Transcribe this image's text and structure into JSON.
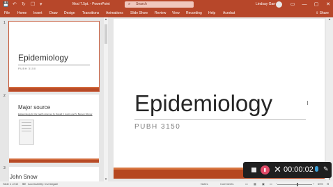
{
  "titlebar": {
    "quick_access": [
      "💾",
      "↶",
      "↻",
      "☐",
      "▾"
    ],
    "title": "Mod 7.5pt.  -  PowerPoint",
    "search_placeholder": "Search",
    "user_name": "Lindsay Garr",
    "window_buttons": [
      "▭",
      "—",
      "▢",
      "✕"
    ]
  },
  "menu": {
    "tabs": [
      "File",
      "Home",
      "Insert",
      "Draw",
      "Design",
      "Transitions",
      "Animations",
      "Slide Show",
      "Review",
      "View",
      "Recording",
      "Help",
      "Acrobat"
    ],
    "share": "Share"
  },
  "thumbnails": [
    {
      "number": "1",
      "title": "Epidemiology",
      "subtitle": "PUBH 3150"
    },
    {
      "number": "2",
      "title": "Major source",
      "caption": "Epidemiology for the health sciences by Donald F. Austin and S. Benson Werner"
    },
    {
      "number": "3",
      "title": "John Snow"
    }
  ],
  "slide": {
    "title": "Epidemiology",
    "subtitle": "PUBH 3150"
  },
  "recorder": {
    "timer": "00:00:02"
  },
  "status": {
    "slide_counter": "Slide 1 of 42",
    "accessibility": "Accessibility: Investigate",
    "notes": "Notes",
    "comments": "Comments",
    "zoom": "65%"
  },
  "colors": {
    "accent": "#b7472a",
    "slide_band": "#b5461f",
    "record_button": "#e04a67"
  }
}
